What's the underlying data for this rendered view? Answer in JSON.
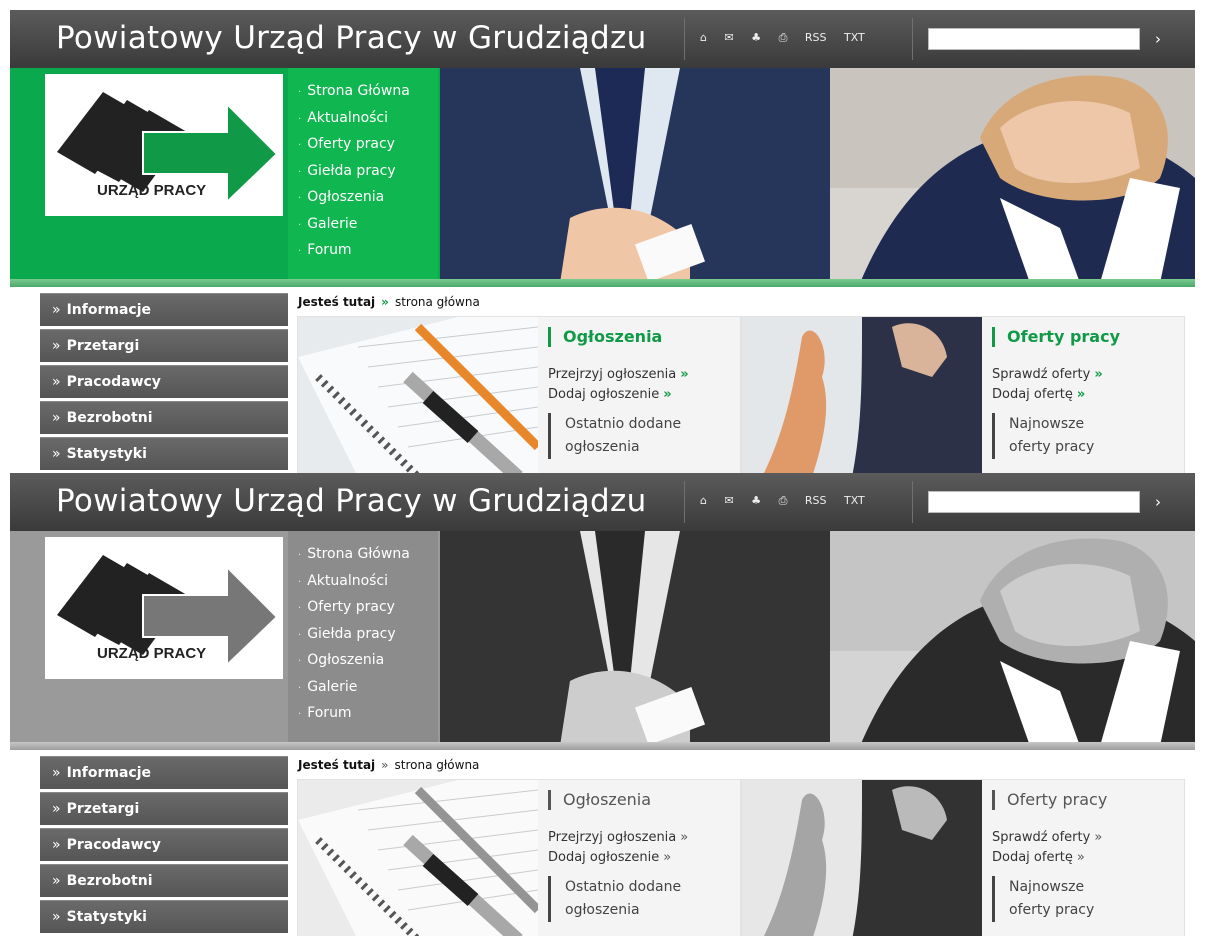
{
  "site": {
    "title": "Powiatowy Urząd Pracy w Grudziądzu",
    "logo_text": "URZĄD PRACY",
    "toolbar": {
      "home_icon": "home-icon",
      "mail_icon": "mail-icon",
      "sitemap_icon": "sitemap-icon",
      "print_icon": "print-icon",
      "rss": "RSS",
      "txt": "TXT",
      "search_go": "›"
    }
  },
  "topnav": [
    "Strona Główna",
    "Aktualności",
    "Oferty pracy",
    "Giełda pracy",
    "Ogłoszenia",
    "Galerie",
    "Forum"
  ],
  "sidenav": [
    "Informacje",
    "Przetargi",
    "Pracodawcy",
    "Bezrobotni",
    "Statystyki"
  ],
  "breadcrumb": {
    "label": "Jesteś tutaj",
    "sep": "»",
    "current": "strona główna"
  },
  "panels": [
    {
      "title": "Ogłoszenia",
      "links": [
        "Przejrzyj ogłoszenia",
        "Dodaj ogłoszenie"
      ],
      "latest_line1": "Ostatnio dodane",
      "latest_line2": "ogłoszenia"
    },
    {
      "title": "Oferty pracy",
      "links": [
        "Sprawdź oferty",
        "Dodaj ofertę"
      ],
      "latest_line1": "Najnowsze",
      "latest_line2": "oferty pracy"
    }
  ],
  "colors": {
    "accent_green": "#109a47",
    "band_green": "#0aa94e",
    "grey_band": "#9a9a9a",
    "topbar": "#4a4a4a"
  }
}
